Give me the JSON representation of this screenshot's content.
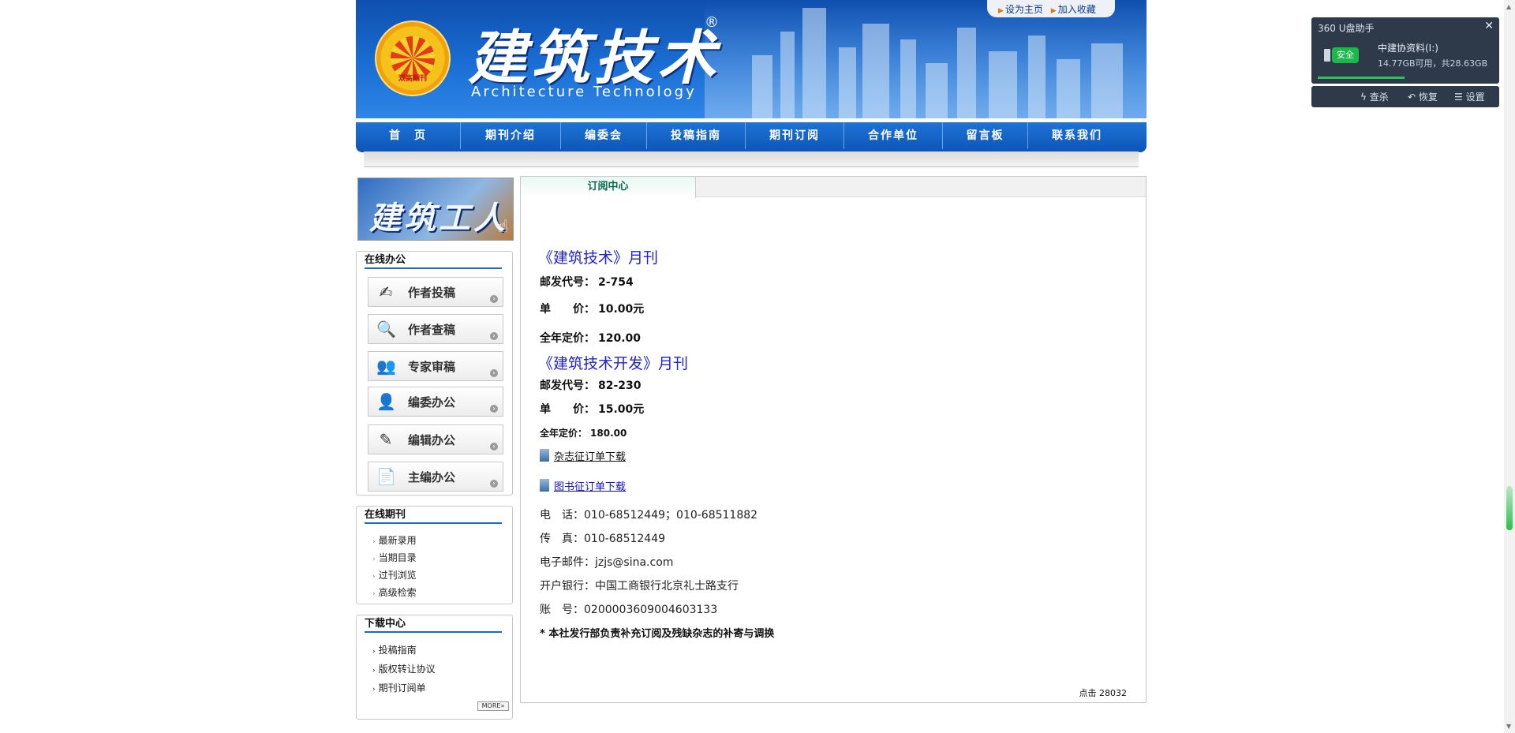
{
  "header": {
    "brand_cn": "建筑技术",
    "brand_reg": "®",
    "brand_en": "Architecture Technology",
    "seal_text": "双高期刊",
    "links": [
      "设为主页",
      "加入收藏"
    ]
  },
  "nav": [
    "首　页",
    "期刊介绍",
    "编委会",
    "投稿指南",
    "期刊订阅",
    "合作单位",
    "留言板",
    "联系我们"
  ],
  "sidebar": {
    "worker_text": "建筑工人",
    "online_office": {
      "title": "在线办公",
      "items": [
        "作者投稿",
        "作者查稿",
        "专家审稿",
        "编委办公",
        "编辑办公",
        "主编办公"
      ]
    },
    "online_journal": {
      "title": "在线期刊",
      "items": [
        "最新录用",
        "当期目录",
        "过刊浏览",
        "高级检索"
      ]
    },
    "download": {
      "title": "下载中心",
      "items": [
        "投稿指南",
        "版权转让协议",
        "期刊订阅单"
      ],
      "more": "MORE»"
    }
  },
  "main": {
    "tab": "订阅中心",
    "mag1": {
      "name": "《建筑技术》月刊",
      "code_label": "邮发代号：",
      "code": "2-754",
      "price_label": "单　　价：",
      "price": "10.00元",
      "year_label": "全年定价：",
      "year": "120.00"
    },
    "mag2": {
      "name": "《建筑技术开发》月刊",
      "code_label": "邮发代号：",
      "code": "82-230",
      "price_label": "单　　价：",
      "price": "15.00元",
      "year_label": "全年定价：",
      "year": "180.00"
    },
    "dl1": "杂志征订单下载",
    "dl2": "图书征订单下载",
    "phone": "电　话：010-68512449；010-68511882",
    "fax": "传　真：010-68512449",
    "email": "电子邮件：jzjs@sina.com",
    "bank": "开户银行：中国工商银行北京礼士路支行",
    "account": "账　号：0200003609004603133",
    "note": "*  本社发行部负责补充订阅及残缺杂志的补寄与调换",
    "hits": "点击 28032"
  },
  "widget": {
    "title": "360 U盘助手",
    "safe": "安全",
    "drive": "中建协资料(I:)",
    "capacity": "14.77GB可用，共28.63GB",
    "actions": [
      "查杀",
      "恢复",
      "设置"
    ]
  }
}
